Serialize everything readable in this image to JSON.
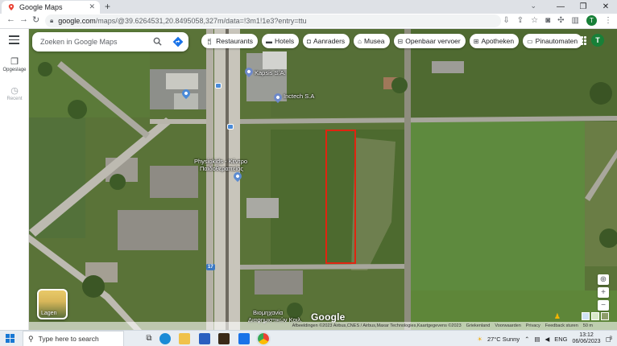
{
  "browser": {
    "tab_title": "Google Maps",
    "new_tab": "+",
    "url_host": "google.com",
    "url_path": "/maps/@39.6264531,20.8495058,327m/data=!3m1!1e3?entry=ttu",
    "profile_initial": "T",
    "window_controls": [
      "⌄",
      "—",
      "❐",
      "✕"
    ]
  },
  "rail": {
    "saved_label": "Opgeslage",
    "recent_label": "Recent"
  },
  "search": {
    "placeholder": "Zoeken in Google Maps"
  },
  "chips": [
    {
      "label": "Restaurants",
      "icon": "fork-knife-icon"
    },
    {
      "label": "Hotels",
      "icon": "bed-icon"
    },
    {
      "label": "Aanraders",
      "icon": "camera-icon"
    },
    {
      "label": "Musea",
      "icon": "museum-icon"
    },
    {
      "label": "Openbaar vervoer",
      "icon": "transit-icon"
    },
    {
      "label": "Apotheken",
      "icon": "pharmacy-icon"
    },
    {
      "label": "Pinautomaten",
      "icon": "atm-icon"
    }
  ],
  "account_initial": "T",
  "map": {
    "labels": {
      "business_a": "Kapsis S.A.",
      "business_b": "Physiokids - Κέντρο",
      "business_b2": "Παιδοθεραπείας",
      "business_c": "Inctech S.A",
      "route_number": "17",
      "bottom_label": "Βιομηχανία",
      "bottom_label2": "Διαφημιστικών Κοιλ."
    },
    "layers_label": "Lagen",
    "google_logo": "Google",
    "attribution": [
      "Afbeeldingen ©2023 Airbus,CNES / Airbus,Maxar Technologies,Kaartgegevens ©2023",
      "Griekenland",
      "Voorwaarden",
      "Privacy",
      "Feedback sturen",
      "50 m"
    ]
  },
  "taskbar": {
    "search_placeholder": "Type here to search",
    "weather": "27°C  Sunny",
    "language": "ENG",
    "time": "13:12",
    "date": "06/06/2023",
    "notification_count": "3"
  },
  "colors": {
    "highlight": "#e02410",
    "accent_green": "#188038",
    "maps_blue": "#1a73e8"
  }
}
